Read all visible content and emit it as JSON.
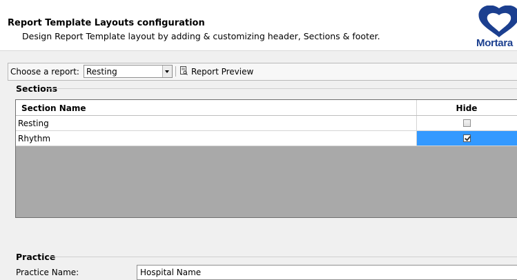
{
  "header": {
    "title": "Report Template Layouts configuration",
    "subtitle": "Design Report Template layout by adding & customizing header, Sections & footer.",
    "logo_text": "Mortara",
    "logo_color": "#1b3f8f"
  },
  "toolbar": {
    "report_label": "Choose a report:",
    "report_value": "Resting",
    "preview_label": "Report Preview",
    "preview_icon": "report-preview-icon"
  },
  "sections": {
    "heading": "Sections",
    "columns": [
      "Section Name",
      "Hide"
    ],
    "rows": [
      {
        "name": "Resting",
        "hidden": false,
        "selected": false
      },
      {
        "name": "Rhythm",
        "hidden": true,
        "selected": true
      }
    ],
    "selection_color": "#3399ff"
  },
  "practice": {
    "heading": "Practice",
    "name_label": "Practice Name:",
    "name_value": "Hospital Name"
  }
}
